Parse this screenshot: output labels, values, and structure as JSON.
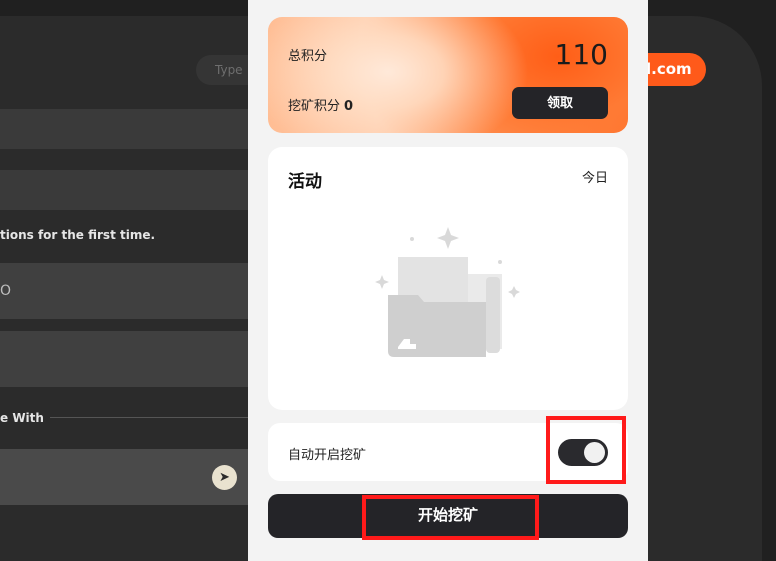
{
  "background": {
    "search_placeholder": "Type",
    "email_pill_text": "l.com",
    "instructions_text": "tions for the first time.",
    "input_value": "O",
    "continue_with_label": "e With",
    "telegram_icon": "telegram-icon"
  },
  "modal": {
    "points": {
      "total_label": "总积分",
      "total_value": "110",
      "mining_label": "挖矿积分",
      "mining_value": "0",
      "claim_button": "领取"
    },
    "activity": {
      "title": "活动",
      "filter": "今日",
      "empty_icon": "empty-folder-icon"
    },
    "auto_mining": {
      "label": "自动开启挖矿",
      "enabled": true
    },
    "start_button": "开始挖矿"
  },
  "colors": {
    "accent_orange": "#ff5a1a",
    "button_dark": "#242428",
    "highlight_red": "#ff1a1a"
  }
}
